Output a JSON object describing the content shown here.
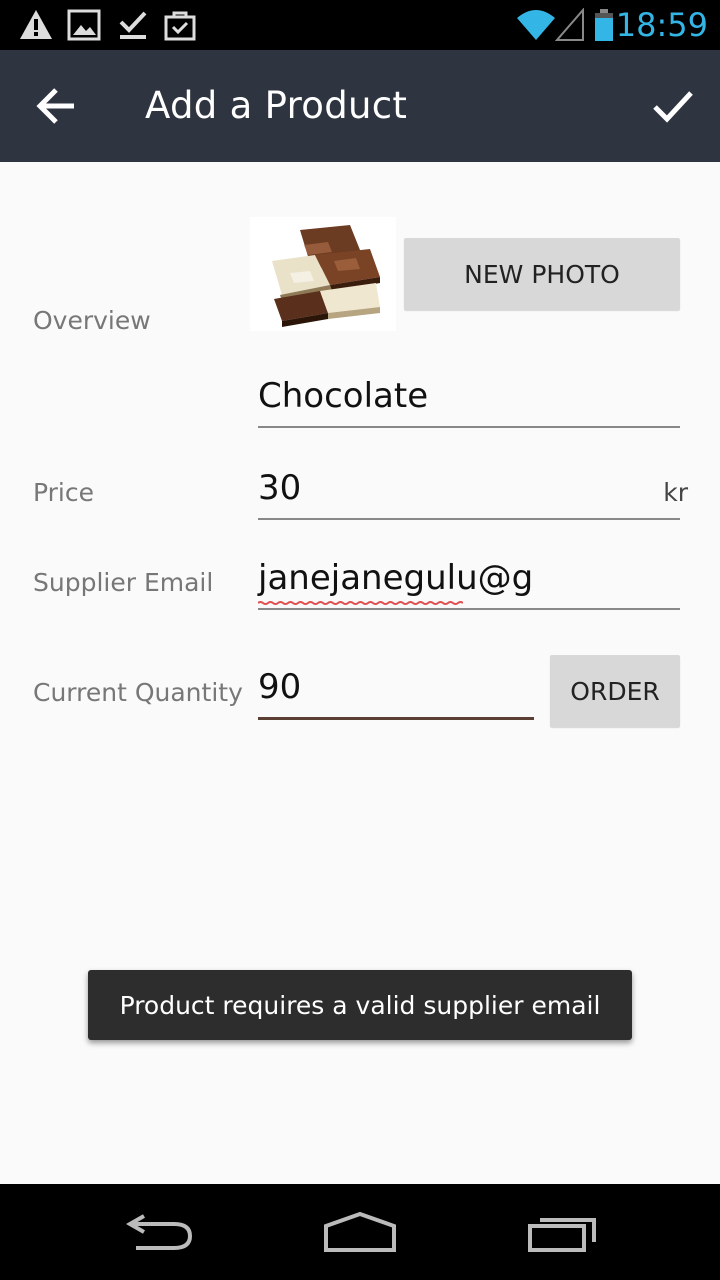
{
  "status_bar": {
    "time": "18:59",
    "icons": [
      "warning-icon",
      "image-icon",
      "download-done-icon",
      "shopping-bag-icon",
      "wifi-icon",
      "signal-icon",
      "battery-icon"
    ]
  },
  "app_bar": {
    "title": "Add a Product",
    "back_icon": "arrow-back-icon",
    "save_icon": "check-icon"
  },
  "form": {
    "overview_label": "Overview",
    "new_photo_label": "NEW PHOTO",
    "name_value": "Chocolate",
    "price_label": "Price",
    "price_value": "30",
    "price_unit": "kr",
    "email_label": "Supplier Email",
    "email_value": "janejanegulu@g",
    "quantity_label": "Current Quantity",
    "quantity_value": "90",
    "order_label": "ORDER"
  },
  "toast": {
    "message": "Product requires a valid supplier email"
  },
  "colors": {
    "app_bar": "#2e3440",
    "accent_time": "#33b5e5",
    "active_underline": "#5b3f33",
    "background": "#fafafa"
  }
}
